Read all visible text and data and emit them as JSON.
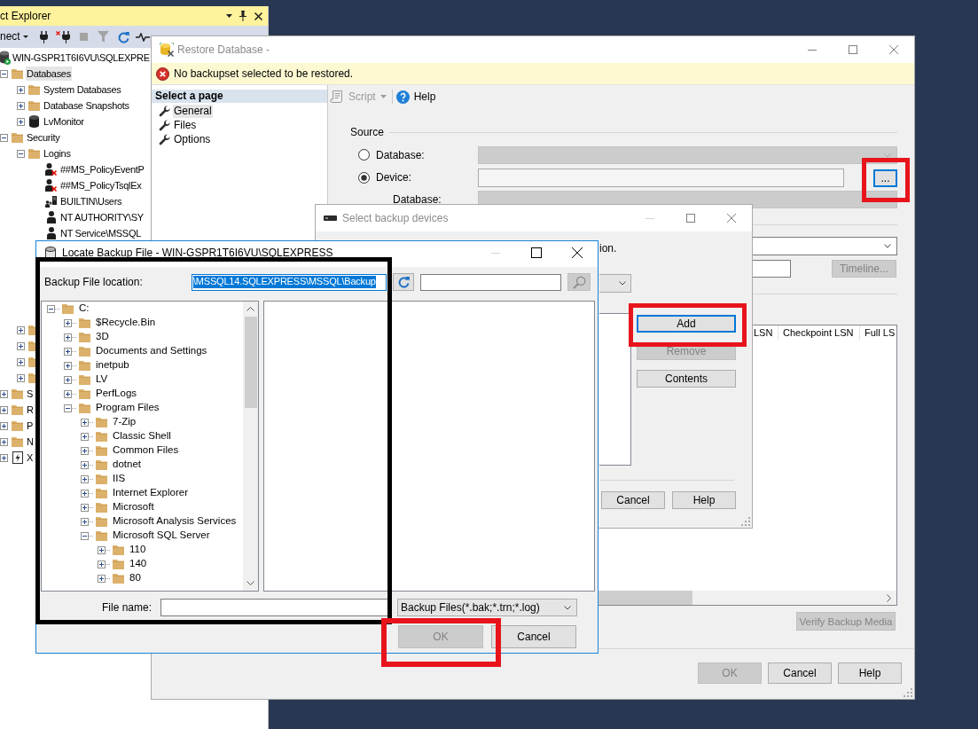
{
  "object_explorer": {
    "title": "ct Explorer",
    "connect_label": "nect",
    "tree": [
      {
        "label": "WIN-GSPR1T6I6VU\\SQLEXPRE",
        "kind": "server",
        "selected": false,
        "children": [
          {
            "label": "Databases",
            "kind": "folder",
            "expanded": true,
            "selected": true,
            "children": [
              {
                "label": "System Databases",
                "kind": "folder",
                "expanded": false,
                "selected": false
              },
              {
                "label": "Database Snapshots",
                "kind": "folder",
                "expanded": false,
                "selected": false
              },
              {
                "label": "LvMonitor",
                "kind": "database",
                "expanded": false,
                "selected": false
              }
            ]
          },
          {
            "label": "Security",
            "kind": "folder",
            "expanded": true,
            "selected": false,
            "children": [
              {
                "label": "Logins",
                "kind": "folder",
                "expanded": true,
                "selected": false,
                "children": [
                  {
                    "label": "##MS_PolicyEventP",
                    "kind": "login-disabled",
                    "selected": false
                  },
                  {
                    "label": "##MS_PolicyTsqlEx",
                    "kind": "login-disabled",
                    "selected": false
                  },
                  {
                    "label": "BUILTIN\\Users",
                    "kind": "group",
                    "selected": false
                  },
                  {
                    "label": "NT AUTHORITY\\SY",
                    "kind": "user",
                    "selected": false
                  },
                  {
                    "label": "NT Service\\MSSQL",
                    "kind": "user",
                    "selected": false
                  }
                ]
              },
              {
                "kind": "folder",
                "expanded": false
              },
              {
                "kind": "folder",
                "expanded": false
              },
              {
                "kind": "folder",
                "expanded": false
              },
              {
                "kind": "folder",
                "expanded": false
              }
            ]
          },
          {
            "label": "S",
            "kind": "folder",
            "expanded": false,
            "selected": false
          },
          {
            "label": "R",
            "kind": "folder",
            "expanded": false,
            "selected": false
          },
          {
            "label": "P",
            "kind": "folder",
            "expanded": false,
            "selected": false
          },
          {
            "label": "N",
            "kind": "folder",
            "expanded": false,
            "selected": false
          },
          {
            "label": "X",
            "kind": "xevent",
            "expanded": false,
            "selected": false
          }
        ]
      }
    ]
  },
  "restore_window": {
    "title": "Restore Database -",
    "active": false,
    "minimize_disabled": false,
    "message": "No backupset selected to be restored.",
    "pages_header": "Select a page",
    "pages": [
      {
        "label": "General",
        "selected": true
      },
      {
        "label": "Files",
        "selected": false
      },
      {
        "label": "Options",
        "selected": false
      }
    ],
    "toolbar": [
      {
        "label": "Script",
        "kind": "script",
        "disabled": true
      },
      {
        "label": "Help",
        "kind": "help",
        "disabled": false
      }
    ],
    "source": {
      "title": "Source",
      "options": [
        {
          "label": "Database:",
          "selected": false,
          "field_disabled": true
        },
        {
          "label": "Device:",
          "selected": true,
          "field_disabled": false
        }
      ],
      "browse_button": {
        "label": "...",
        "focused": true,
        "highlighted": true
      },
      "database_label": "Database:",
      "database_field_disabled": true
    },
    "timeline_button": {
      "label": "Timeline...",
      "disabled": true
    },
    "grid_columns": [
      "LSN",
      "Checkpoint LSN",
      "Full LS"
    ],
    "verify_button": {
      "label": "Verify Backup Media",
      "disabled": true
    },
    "buttons": [
      {
        "label": "OK",
        "disabled": true
      },
      {
        "label": "Cancel",
        "disabled": false
      },
      {
        "label": "Help",
        "disabled": false
      }
    ]
  },
  "select_window": {
    "title": "Select backup devices",
    "active": false,
    "minimize_disabled": true,
    "instruction": "ion.",
    "side_buttons": [
      {
        "label": "Add",
        "disabled": false,
        "focused": true,
        "highlighted": true
      },
      {
        "label": "Remove",
        "disabled": true,
        "focused": false,
        "highlighted": false
      },
      {
        "label": "Contents",
        "disabled": false,
        "focused": false,
        "highlighted": false
      }
    ],
    "buttons": [
      {
        "label": "Cancel",
        "disabled": false
      },
      {
        "label": "Help",
        "disabled": false
      }
    ]
  },
  "locate_window": {
    "title": "Locate Backup File - WIN-GSPR1T6I6VU\\SQLEXPRESS",
    "active": true,
    "minimize_disabled": true,
    "outlined": true,
    "location": {
      "label": "Backup File location:",
      "value": "\\MSSQL14.SQLEXPRESS\\MSSQL\\Backup",
      "value_selected": true
    },
    "search_disabled": true,
    "tree": [
      {
        "label": "C:",
        "expanded": true,
        "children": [
          {
            "label": "$Recycle.Bin",
            "expanded": false
          },
          {
            "label": "3D",
            "expanded": false
          },
          {
            "label": "Documents and Settings",
            "expanded": false
          },
          {
            "label": "inetpub",
            "expanded": false
          },
          {
            "label": "LV",
            "expanded": false
          },
          {
            "label": "PerfLogs",
            "expanded": false
          },
          {
            "label": "Program Files",
            "expanded": true,
            "children": [
              {
                "label": "7-Zip",
                "expanded": false
              },
              {
                "label": "Classic Shell",
                "expanded": false
              },
              {
                "label": "Common Files",
                "expanded": false
              },
              {
                "label": "dotnet",
                "expanded": false
              },
              {
                "label": "IIS",
                "expanded": false
              },
              {
                "label": "Internet Explorer",
                "expanded": false
              },
              {
                "label": "Microsoft",
                "expanded": false
              },
              {
                "label": "Microsoft Analysis Services",
                "expanded": false
              },
              {
                "label": "Microsoft SQL Server",
                "expanded": true,
                "children": [
                  {
                    "label": "110",
                    "expanded": false
                  },
                  {
                    "label": "140",
                    "expanded": false
                  },
                  {
                    "label": "80",
                    "expanded": false
                  }
                ]
              }
            ]
          }
        ]
      }
    ],
    "file_name_label": "File name:",
    "file_type": "Backup Files(*.bak;*.trn;*.log)",
    "buttons": [
      {
        "label": "OK",
        "disabled": true,
        "highlighted": true
      },
      {
        "label": "Cancel",
        "disabled": false,
        "highlighted": false
      }
    ]
  }
}
